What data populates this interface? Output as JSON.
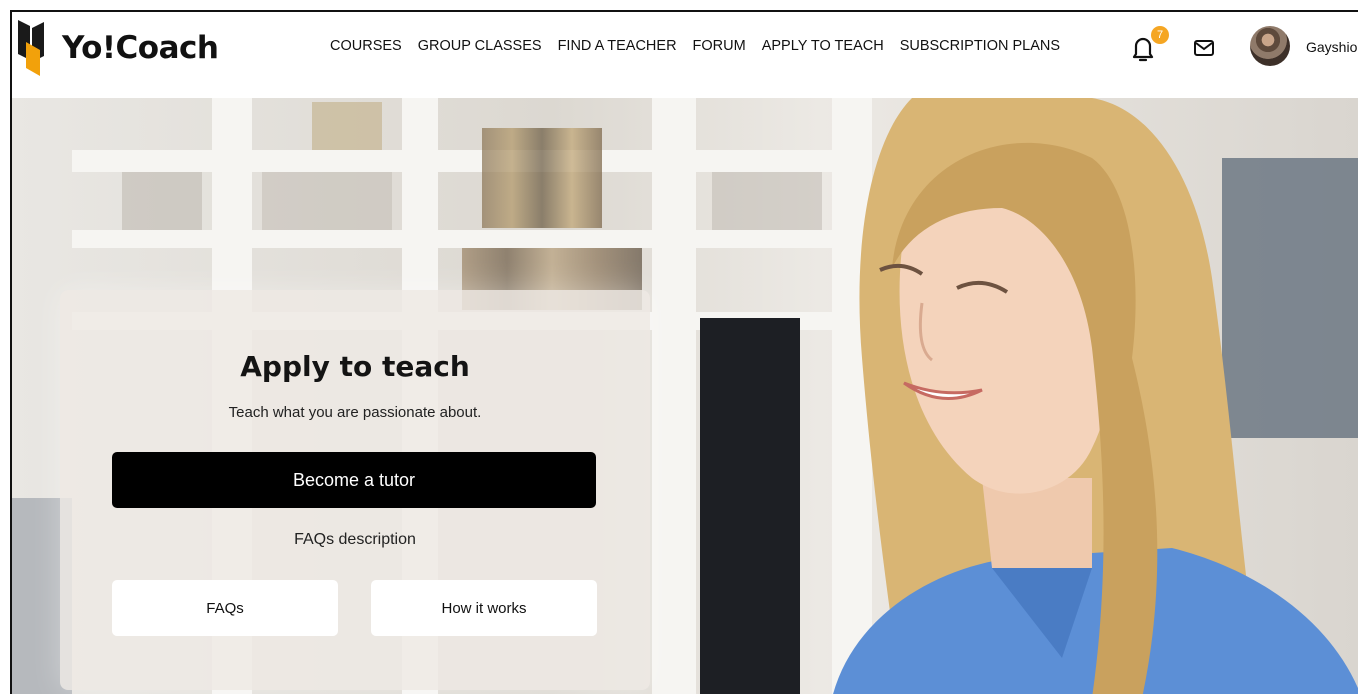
{
  "brand": {
    "name": "Yo!Coach"
  },
  "nav": {
    "items": [
      "COURSES",
      "GROUP CLASSES",
      "FIND A TEACHER",
      "FORUM",
      "APPLY TO TEACH",
      "SUBSCRIPTION PLANS"
    ]
  },
  "header": {
    "notification_count": "7",
    "username": "Gayshio"
  },
  "hero": {
    "title": "Apply to teach",
    "subtitle": "Teach what you are passionate about.",
    "primary_button": "Become a tutor",
    "faq_description": "FAQs description",
    "faq_button": "FAQs",
    "how_button": "How it works"
  },
  "colors": {
    "badge": "#f5a623",
    "logo_dark": "#1a1a1a",
    "logo_accent": "#f2a10b",
    "primary_button": "#000000",
    "shirt": "#5c8fd6",
    "hair": "#d9b574"
  }
}
